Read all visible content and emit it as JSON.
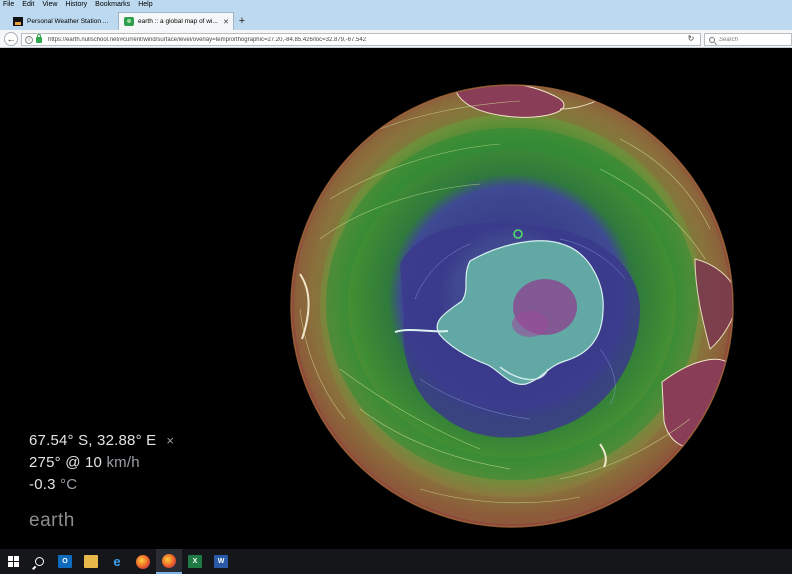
{
  "menubar": {
    "items": [
      "File",
      "Edit",
      "View",
      "History",
      "Bookmarks",
      "Help"
    ]
  },
  "tabs": [
    {
      "title": "Personal Weather Station ...",
      "active": false
    },
    {
      "title": "earth :: a global map of wi...",
      "active": true
    }
  ],
  "navbar": {
    "url": "https://earth.nullschool.net/#current/wind/surface/level/overlay=temp/orthographic=27.20,-84.85,426/loc=32.879,-67.542",
    "search_placeholder": "Search"
  },
  "location_panel": {
    "coordinates": "67.54° S, 32.88° E",
    "close_symbol": "×",
    "wind_direction": "275°",
    "wind_at": "@",
    "wind_speed": "10",
    "wind_unit": "km/h",
    "temperature": "-0.3",
    "temperature_unit": "°C"
  },
  "brand": "earth",
  "taskbar": {
    "apps": [
      "start",
      "search",
      "outlook",
      "file-explorer",
      "edge",
      "firefox",
      "firefox-active",
      "excel",
      "word"
    ]
  },
  "colors": {
    "menubar_bg": "#bcd9ef",
    "marker": "#4ee06a"
  }
}
